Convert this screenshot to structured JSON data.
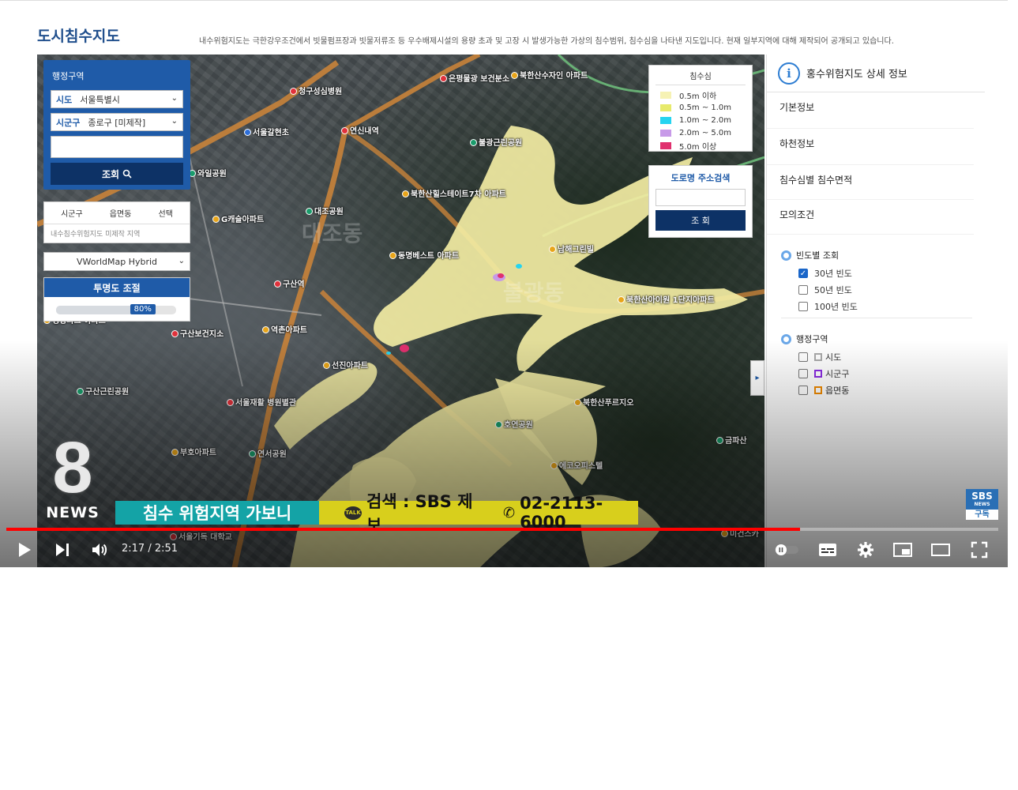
{
  "site": {
    "title": "도시침수지도",
    "description": "내수위험지도는 극한강우조건에서 빗물펌프장과 빗물저류조 등 우수배제시설의 용량 초과 및 고장 시 발생가능한 가상의 침수범위, 침수심을 나타낸 지도입니다. 현재 일부지역에 대해 제작되어 공개되고 있습니다."
  },
  "search_panel": {
    "title": "행정구역",
    "sido_label": "시도",
    "sido_value": "서울특별시",
    "sigungu_label": "시군구",
    "sigungu_value": "종로구 [미제작]",
    "search_button": "조회",
    "result_headers": [
      "시군구",
      "읍면동",
      "선택"
    ],
    "result_row": "내수침수위험지도 미제작 지역"
  },
  "basemap": {
    "selected": "VWorldMap Hybrid"
  },
  "opacity": {
    "title": "투명도 조절",
    "value_label": "80%",
    "value": 0.8
  },
  "legend": {
    "title": "침수심",
    "items": [
      {
        "label": "0.5m 이하",
        "color": "#f6f2b4"
      },
      {
        "label": "0.5m ~ 1.0m",
        "color": "#e7ea6b"
      },
      {
        "label": "1.0m ~ 2.0m",
        "color": "#25d4f0"
      },
      {
        "label": "2.0m ~ 5.0m",
        "color": "#c79ae8"
      },
      {
        "label": "5.0m 이상",
        "color": "#e0306e"
      }
    ]
  },
  "road_search": {
    "title": "도로명 주소검색",
    "button": "조 회"
  },
  "map_labels": [
    {
      "text": "청구성심병원",
      "kind": "red"
    },
    {
      "text": "은평물광 보건분소",
      "kind": "red"
    },
    {
      "text": "북한산수자인 아파트",
      "kind": "orange"
    },
    {
      "text": "연신내역",
      "kind": "red"
    },
    {
      "text": "서울갈현초",
      "kind": "blue"
    },
    {
      "text": "불광근린공원",
      "kind": "green"
    },
    {
      "text": "와일공원",
      "kind": "green"
    },
    {
      "text": "북한산힐스테이트7차 아파트",
      "kind": "orange"
    },
    {
      "text": "대조공원",
      "kind": "green"
    },
    {
      "text": "G캐슬아파트",
      "kind": "orange"
    },
    {
      "text": "남해그린빌",
      "kind": "orange"
    },
    {
      "text": "동명베스트 아파트",
      "kind": "orange"
    },
    {
      "text": "구산역",
      "kind": "red"
    },
    {
      "text": "북한산아이원 1단지아파트",
      "kind": "orange"
    },
    {
      "text": "경향파크 아파트",
      "kind": "orange"
    },
    {
      "text": "구산보건지소",
      "kind": "red"
    },
    {
      "text": "역촌아파트",
      "kind": "orange"
    },
    {
      "text": "선진아파트",
      "kind": "orange"
    },
    {
      "text": "구산근린공원",
      "kind": "green"
    },
    {
      "text": "서울재활 병원별관",
      "kind": "red"
    },
    {
      "text": "북한산푸르지오",
      "kind": "orange"
    },
    {
      "text": "호연공원",
      "kind": "green"
    },
    {
      "text": "부호아파트",
      "kind": "orange"
    },
    {
      "text": "연서공원",
      "kind": "green"
    },
    {
      "text": "에코오피스텔",
      "kind": "orange"
    },
    {
      "text": "금파산",
      "kind": "green"
    },
    {
      "text": "서울기독 대학교",
      "kind": "red"
    },
    {
      "text": "미건스카",
      "kind": "orange"
    }
  ],
  "map_districts": [
    "대조동",
    "불광동"
  ],
  "detail_panel": {
    "title": "홍수위험지도 상세 정보",
    "sections": [
      "기본정보",
      "하천정보",
      "침수심별 침수면적",
      "모의조건"
    ],
    "frequency_group": {
      "title": "빈도별 조회",
      "options": [
        {
          "label": "30년 빈도",
          "checked": true
        },
        {
          "label": "50년 빈도",
          "checked": false
        },
        {
          "label": "100년 빈도",
          "checked": false
        }
      ]
    },
    "admin_group": {
      "title": "행정구역",
      "options": [
        {
          "label": "시도",
          "color": "#aaaaaa"
        },
        {
          "label": "시군구",
          "color": "#8a2be2"
        },
        {
          "label": "읍면동",
          "color": "#f08a00"
        }
      ]
    }
  },
  "news": {
    "logo_number": "8",
    "logo_text": "NEWS",
    "caption_main": "침수 위험지역 가보니",
    "talk_icon_text": "TALK",
    "caption_search": "검색 : SBS 제보",
    "caption_phone": "02-2113-6000",
    "badge_top": "SBS",
    "badge_mid": "NEWS",
    "badge_bottom": "구독"
  },
  "player": {
    "current_time": "2:17",
    "duration": "2:51",
    "time_display": "2:17 / 2:51",
    "progress": 0.8
  }
}
